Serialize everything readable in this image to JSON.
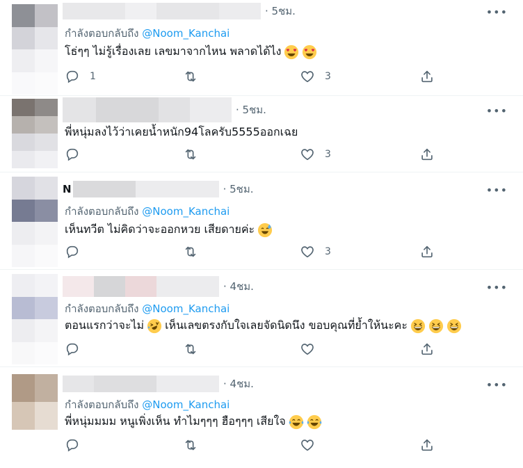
{
  "tweets": [
    {
      "time": "· 5ชม.",
      "more": "•••",
      "reply_prefix": "กำลังตอบกลับถึง",
      "reply_handle": "@Noom_Kanchai",
      "text": "โธ่ๆๆ ไม่รู้เรื่องเลย เลขมาจากไหน พลาดได้ไง",
      "emojis": [
        "heart-eyes",
        "heart-eyes"
      ],
      "reply_count": "1",
      "retweet_count": "",
      "like_count": "3"
    },
    {
      "time": "· 5ชม.",
      "more": "•••",
      "reply_prefix": "",
      "reply_handle": "",
      "text": "พี่หนุ่มลงไว้ว่าเคยน้ำหนัก94โลครับ5555ออกเฉย",
      "emojis": [],
      "reply_count": "",
      "retweet_count": "",
      "like_count": "3"
    },
    {
      "time": "· 5ชม.",
      "more": "•••",
      "name_initial": "N",
      "reply_prefix": "กำลังตอบกลับถึง",
      "reply_handle": "@Noom_Kanchai",
      "text": "เห็นทวีต ไม่คิดว่าจะออกหวย  เสียดายค่ะ",
      "emojis": [
        "sweat-smile"
      ],
      "reply_count": "",
      "retweet_count": "",
      "like_count": "3"
    },
    {
      "time": "· 4ชม.",
      "more": "•••",
      "reply_prefix": "กำลังตอบกลับถึง",
      "reply_handle": "@Noom_Kanchai",
      "text_a": "ตอนแรกว่าจะไม่",
      "text_b": "เห็นเลขตรงกับใจเลยจัดนิดนึง ขอบคุณที่ย้ำให้นะคะ",
      "emojis": [
        "rofl",
        "grin-squint",
        "grin-squint",
        "grin-squint"
      ],
      "reply_count": "",
      "retweet_count": "",
      "like_count": ""
    },
    {
      "time": "· 4ชม.",
      "more": "•••",
      "reply_prefix": "กำลังตอบกลับถึง",
      "reply_handle": "@Noom_Kanchai",
      "text": "พี่หนุ่มมมม หนูเพิ่งเห็น ทำไมๆๆๆ ฮือๆๆๆ เสียใจ",
      "emojis": [
        "joy",
        "joy"
      ],
      "reply_count": "",
      "retweet_count": "",
      "like_count": ""
    }
  ],
  "colors": {
    "secondary_text": "#536471",
    "handle": "#1d9bf0",
    "divider": "#eff3f4"
  }
}
